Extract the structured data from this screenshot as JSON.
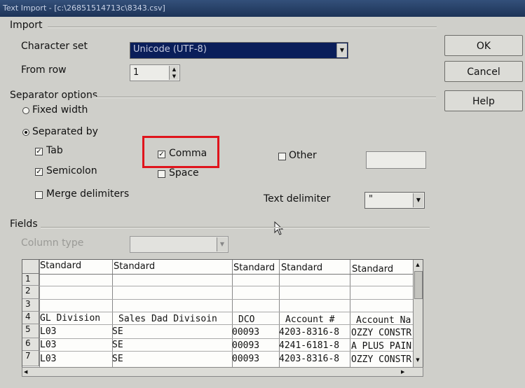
{
  "window": {
    "title": "Text Import - [c:\\26851514713c\\8343.csv]"
  },
  "import": {
    "section_label": "Import",
    "charset_label": "Character set",
    "charset_value": "Unicode (UTF-8)",
    "from_row_label": "From row",
    "from_row_value": "1"
  },
  "buttons": {
    "ok": "OK",
    "cancel": "Cancel",
    "help": "Help"
  },
  "separator": {
    "section_label": "Separator options",
    "fixed_width": "Fixed width",
    "separated_by": "Separated by",
    "tab": "Tab",
    "semicolon": "Semicolon",
    "comma": "Comma",
    "space": "Space",
    "other": "Other",
    "merge": "Merge delimiters",
    "text_delimiter_label": "Text delimiter",
    "text_delimiter_value": "\""
  },
  "fields": {
    "section_label": "Fields",
    "column_type_label": "Column type",
    "headers": [
      "Standard",
      "Standard",
      "Standard",
      "Standard",
      "Standard"
    ],
    "row_numbers": [
      "1",
      "2",
      "3",
      "4",
      "5",
      "6",
      "7"
    ],
    "rows": [
      [
        "",
        "",
        "",
        "",
        ""
      ],
      [
        "",
        "",
        "",
        "",
        ""
      ],
      [
        "",
        "",
        "",
        "",
        ""
      ],
      [
        "GL Division",
        "Sales Dad Divisoin",
        "DCO",
        "Account #",
        "Account Na"
      ],
      [
        "L03",
        "SE",
        "00093",
        "4203-8316-8",
        "OZZY CONSTR"
      ],
      [
        "L03",
        "SE",
        "00093",
        "4241-6181-8",
        "A PLUS PAIN"
      ],
      [
        "L03",
        "SE",
        "00093",
        "4203-8316-8",
        "OZZY CONSTR"
      ]
    ]
  },
  "colors": {
    "highlight": "#e0141c",
    "combo_selected": "#0a1e5a"
  }
}
